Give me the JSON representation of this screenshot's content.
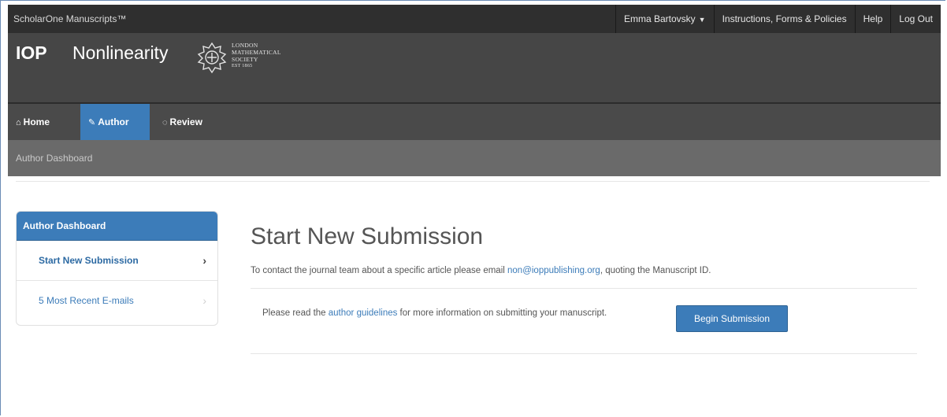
{
  "topbar": {
    "brand": "ScholarOne Manuscripts™",
    "user_menu": "Emma Bartovsky",
    "links": [
      "Instructions, Forms & Policies",
      "Help",
      "Log Out"
    ]
  },
  "header": {
    "publisher_logo": "IOP",
    "journal_name": "Nonlinearity",
    "society_logo_lines": [
      "LONDON",
      "MATHEMATICAL",
      "SOCIETY",
      "EST 1865"
    ]
  },
  "nav": {
    "tabs": [
      {
        "label": "Home",
        "icon": "home-icon"
      },
      {
        "label": "Author",
        "icon": "pencil-icon",
        "active": true
      },
      {
        "label": "Review",
        "icon": "comment-icon"
      }
    ]
  },
  "breadcrumb": "Author Dashboard",
  "sidebar": {
    "title": "Author Dashboard",
    "items": [
      {
        "label": "Start New Submission",
        "active": true
      },
      {
        "label": "5 Most Recent E-mails",
        "active": false
      }
    ]
  },
  "main": {
    "title": "Start New Submission",
    "contact_prefix": "To contact the journal team about a specific article please email ",
    "contact_email": "non@ioppublishing.org",
    "contact_suffix": ", quoting the Manuscript ID.",
    "guidelines_prefix": "Please read the ",
    "guidelines_link": "author guidelines",
    "guidelines_suffix": " for more information on submitting your manuscript.",
    "begin_button": "Begin Submission"
  },
  "colors": {
    "accent": "#3c7cb9",
    "topbar": "#2f2f2f",
    "header": "#464646",
    "nav": "#4a4a4a",
    "breadcrumb_bar": "#6a6a6a"
  }
}
